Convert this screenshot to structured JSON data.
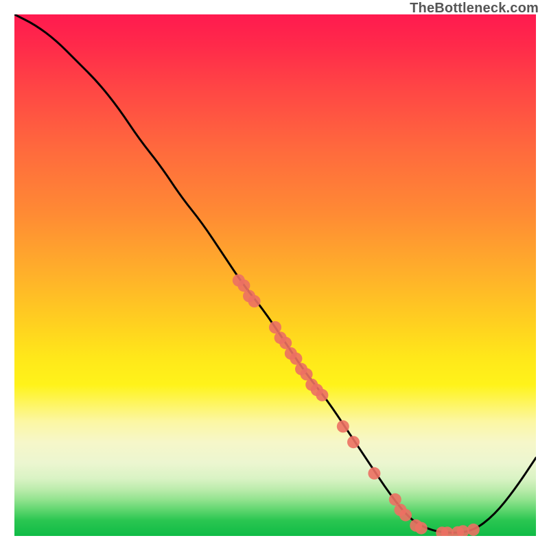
{
  "attribution": "TheBottleneck.com",
  "chart_data": {
    "type": "line",
    "title": "",
    "xlabel": "",
    "ylabel": "",
    "xlim": [
      0,
      100
    ],
    "ylim": [
      0,
      100
    ],
    "grid": false,
    "legend": false,
    "series": [
      {
        "name": "bottleneck-curve",
        "x": [
          0,
          4,
          8,
          12,
          16,
          20,
          24,
          28,
          32,
          36,
          40,
          44,
          48,
          52,
          56,
          60,
          64,
          68,
          72,
          76,
          80,
          84,
          88,
          92,
          96,
          100
        ],
        "y": [
          100,
          98,
          95,
          91,
          87,
          82,
          76,
          71,
          65,
          60,
          54,
          48,
          43,
          37,
          31,
          26,
          20,
          14,
          8,
          3,
          1,
          0.5,
          1,
          4,
          9,
          15
        ]
      }
    ],
    "markers": [
      {
        "name": "marker-1",
        "x": 43,
        "y": 49
      },
      {
        "name": "marker-2",
        "x": 44,
        "y": 48
      },
      {
        "name": "marker-3",
        "x": 45,
        "y": 46
      },
      {
        "name": "marker-4",
        "x": 46,
        "y": 45
      },
      {
        "name": "marker-5",
        "x": 50,
        "y": 40
      },
      {
        "name": "marker-6",
        "x": 51,
        "y": 38
      },
      {
        "name": "marker-7",
        "x": 52,
        "y": 37
      },
      {
        "name": "marker-8",
        "x": 53,
        "y": 35
      },
      {
        "name": "marker-9",
        "x": 54,
        "y": 34
      },
      {
        "name": "marker-10",
        "x": 55,
        "y": 32
      },
      {
        "name": "marker-11",
        "x": 56,
        "y": 31
      },
      {
        "name": "marker-12",
        "x": 57,
        "y": 29
      },
      {
        "name": "marker-13",
        "x": 58,
        "y": 28
      },
      {
        "name": "marker-14",
        "x": 59,
        "y": 27
      },
      {
        "name": "marker-15",
        "x": 63,
        "y": 21
      },
      {
        "name": "marker-16",
        "x": 65,
        "y": 18
      },
      {
        "name": "marker-17",
        "x": 69,
        "y": 12
      },
      {
        "name": "marker-18",
        "x": 73,
        "y": 7
      },
      {
        "name": "marker-19",
        "x": 74,
        "y": 5
      },
      {
        "name": "marker-20",
        "x": 75,
        "y": 4
      },
      {
        "name": "marker-21",
        "x": 77,
        "y": 2
      },
      {
        "name": "marker-22",
        "x": 78,
        "y": 1.5
      },
      {
        "name": "marker-23",
        "x": 82,
        "y": 0.6
      },
      {
        "name": "marker-24",
        "x": 83,
        "y": 0.6
      },
      {
        "name": "marker-25",
        "x": 85,
        "y": 0.7
      },
      {
        "name": "marker-26",
        "x": 86,
        "y": 0.9
      },
      {
        "name": "marker-27",
        "x": 88,
        "y": 1.2
      }
    ],
    "colors": {
      "curve": "#000000",
      "marker_fill": "#ec7063",
      "marker_stroke": "#c0504d"
    }
  }
}
